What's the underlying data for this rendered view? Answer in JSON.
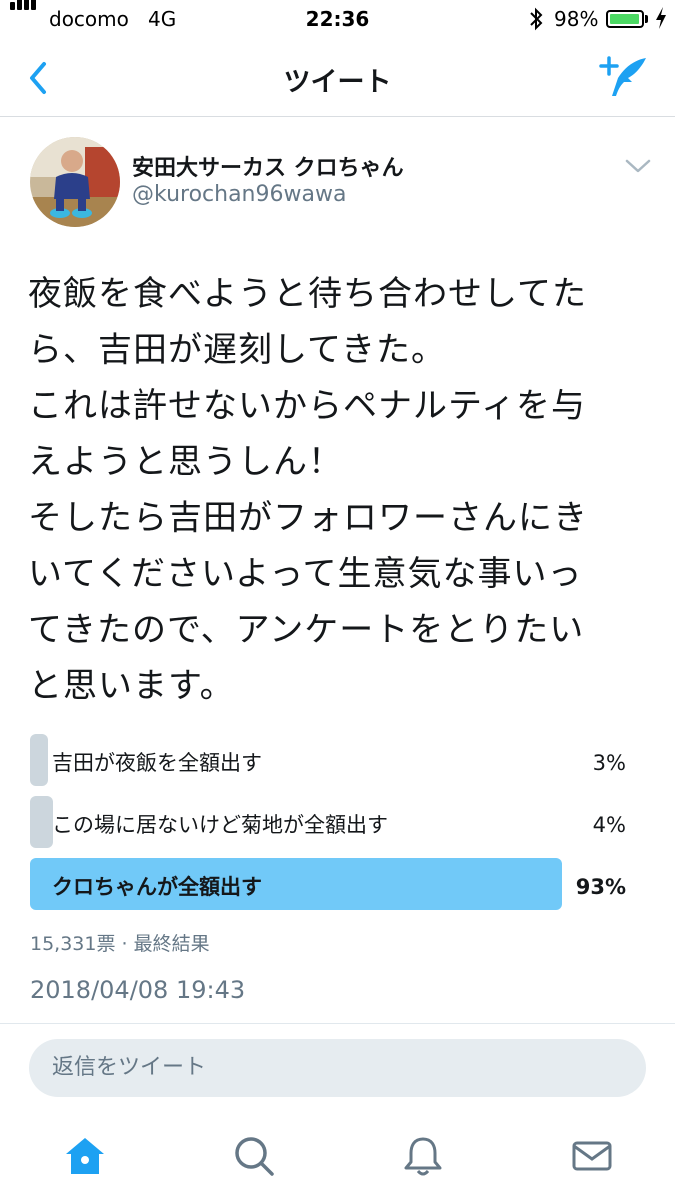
{
  "status_bar": {
    "carrier": "docomo",
    "network": "4G",
    "time": "22:36",
    "battery": "98%",
    "battery_level": 0.98,
    "icons": [
      "signal-bars-icon",
      "bluetooth-icon",
      "battery-icon",
      "charging-bolt-icon"
    ]
  },
  "nav": {
    "title": "ツイート",
    "back_icon": "chevron-left-icon",
    "compose_icon": "compose-tweet-icon"
  },
  "tweet": {
    "display_name": "安田大サーカス クロちゃん",
    "handle": "@kurochan96wawa",
    "text_lines": [
      "夜飯を食べようと待ち合わせしてた",
      "ら、吉田が遅刻してきた。",
      "これは許せないからペナルティを与",
      "えようと思うしん！",
      "そしたら吉田がフォロワーさんにき",
      "いてくださいよって生意気な事いっ",
      "てきたので、アンケートをとりたい",
      "と思います。"
    ],
    "timestamp": "2018/04/08 19:43"
  },
  "poll": {
    "options": [
      {
        "label": "吉田が夜飯を全額出す",
        "percent_label": "3%",
        "percent": 3
      },
      {
        "label": "この場に居ないけど菊地が全額出す",
        "percent_label": "4%",
        "percent": 4
      },
      {
        "label": "クロちゃんが全額出す",
        "percent_label": "93%",
        "percent": 93
      }
    ],
    "meta": "15,331票 · 最終結果",
    "winner_color": "#71c9f8",
    "loser_color": "#ccd6dd"
  },
  "reply": {
    "placeholder": "返信をツイート"
  },
  "tab_bar": {
    "tabs": [
      "home-icon",
      "search-icon",
      "notifications-bell-icon",
      "messages-envelope-icon"
    ],
    "active": "home-icon",
    "accent": "#1da1f2"
  }
}
